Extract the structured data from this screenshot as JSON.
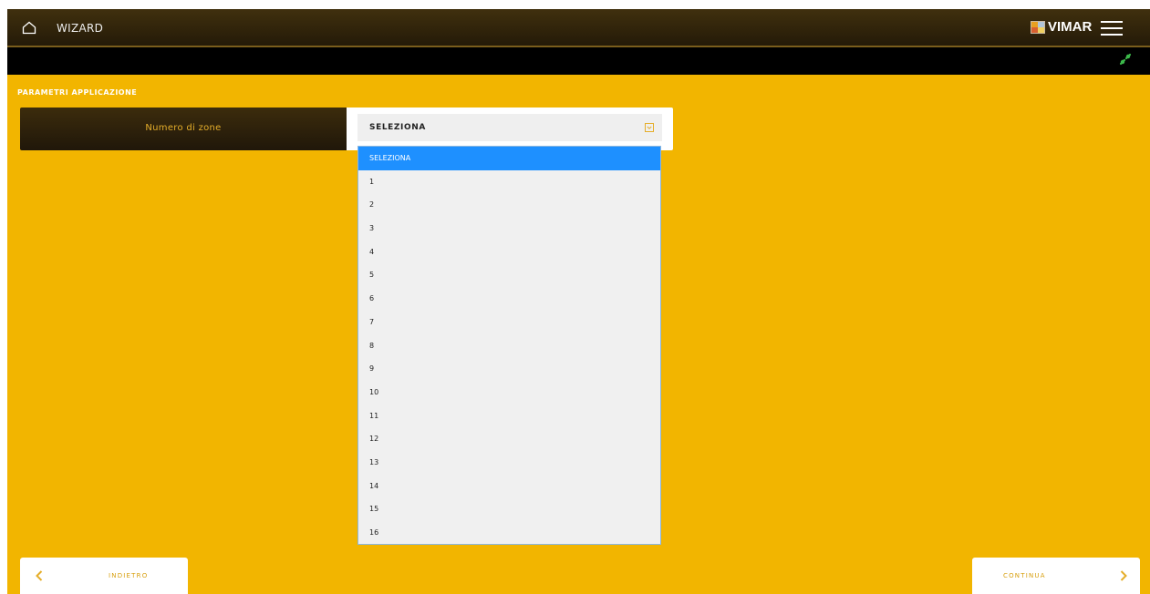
{
  "header": {
    "title": "WIZARD",
    "brand": "VIMAR",
    "icons": [
      "home-icon",
      "menu-icon",
      "connection-link-icon"
    ]
  },
  "section": {
    "title": "PARAMETRI APPLICAZIONE"
  },
  "parameter": {
    "label": "Numero di zone",
    "selected_value": "SELEZIONA"
  },
  "dropdown": {
    "options": [
      "SELEZIONA",
      "1",
      "2",
      "3",
      "4",
      "5",
      "6",
      "7",
      "8",
      "9",
      "10",
      "11",
      "12",
      "13",
      "14",
      "15",
      "16"
    ],
    "highlighted_option": "SELEZIONA"
  },
  "footer": {
    "back_label": "INDIETRO",
    "next_label": "CONTINUA"
  },
  "colors": {
    "background": "#f2b500",
    "accent": "#e5ae2a",
    "dark": "#2a1e08",
    "highlight": "#1e90ff",
    "connection_icon": "#3cb84a"
  }
}
